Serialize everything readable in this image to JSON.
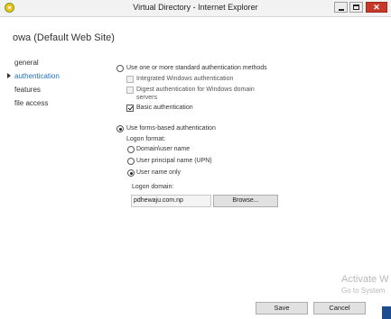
{
  "window": {
    "title": "Virtual Directory - Internet Explorer"
  },
  "site_heading": "owa (Default Web Site)",
  "nav": {
    "items": [
      {
        "label": "general",
        "active": false
      },
      {
        "label": "authentication",
        "active": true
      },
      {
        "label": "features",
        "active": false
      },
      {
        "label": "file access",
        "active": false
      }
    ]
  },
  "auth": {
    "standard_option": {
      "label": "Use one or more standard authentication methods",
      "selected": false
    },
    "integrated": {
      "label": "Integrated Windows authentication",
      "checked": false
    },
    "digest_line1": "Digest authentication for Windows domain",
    "digest_line2": "servers",
    "digest": {
      "checked": false
    },
    "basic": {
      "label": "Basic authentication",
      "checked": true
    },
    "forms_option": {
      "label": "Use forms-based authentication",
      "selected": true
    },
    "logon_format_label": "Logon format:",
    "formats": [
      {
        "label": "Domain\\user name",
        "selected": false
      },
      {
        "label": "User principal name (UPN)",
        "selected": false
      },
      {
        "label": "User name only",
        "selected": true
      }
    ],
    "logon_domain_label": "Logon domain:",
    "logon_domain_value": "pdhewaju.com.np",
    "browse_label": "Browse..."
  },
  "footer": {
    "save_label": "Save",
    "cancel_label": "Cancel"
  },
  "watermark": {
    "title": "Activate W",
    "subtitle": "Go to System"
  }
}
